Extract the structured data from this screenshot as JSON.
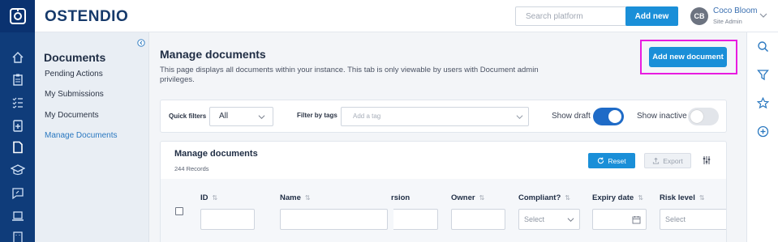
{
  "header": {
    "brand": "OSTENDIO",
    "search_placeholder": "Search platform",
    "add_new_label": "Add new",
    "user": {
      "initials": "CB",
      "name": "Coco Bloom",
      "role": "Site Admin"
    }
  },
  "rail_icons": [
    "home-icon",
    "clipboard-icon",
    "checklist-icon",
    "add-document-icon",
    "document-icon",
    "graduation-cap-icon",
    "chat-icon",
    "laptop-icon",
    "building-icon"
  ],
  "subnav": {
    "title": "Documents",
    "items": [
      {
        "label": "Pending Actions"
      },
      {
        "label": "My Submissions"
      },
      {
        "label": "My Documents"
      },
      {
        "label": "Manage Documents"
      }
    ]
  },
  "page": {
    "title": "Manage documents",
    "description": "This page displays all documents within your instance. This tab is only viewable by users with Document admin privileges.",
    "add_document_label": "Add new document"
  },
  "filters": {
    "quick_label": "Quick filters",
    "quick_value": "All",
    "tags_label": "Filter by tags",
    "tags_placeholder": "Add a tag",
    "show_draft_label": "Show draft",
    "show_draft_on": true,
    "show_inactive_label": "Show inactive",
    "show_inactive_on": false
  },
  "table": {
    "title": "Manage documents",
    "records": "244 Records",
    "reset_label": "Reset",
    "export_label": "Export",
    "columns": [
      {
        "label": "ID"
      },
      {
        "label": "Name"
      },
      {
        "label": "rsion"
      },
      {
        "label": "Owner"
      },
      {
        "label": "Compliant?"
      },
      {
        "label": "Expiry date"
      },
      {
        "label": "Risk level"
      }
    ],
    "select_placeholder": "Select"
  },
  "colors": {
    "accent": "#1a8fd8",
    "rail": "#0f3c7a",
    "highlight": "#e81ce0"
  }
}
